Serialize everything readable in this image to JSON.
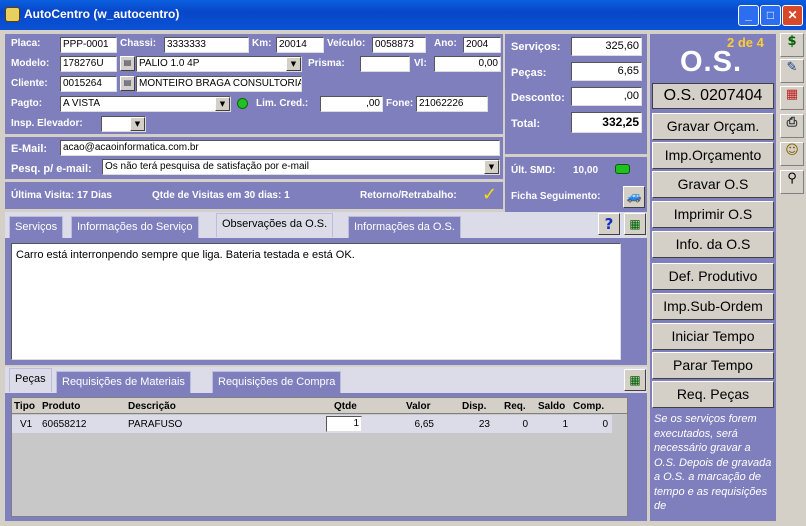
{
  "window": {
    "title": "AutoCentro (w_autocentro)",
    "minimize": "_",
    "maximize": "□",
    "close": "✕"
  },
  "vehicle": {
    "placa_label": "Placa:",
    "placa": "PPP-0001",
    "chassi_label": "Chassi:",
    "chassi": "3333333",
    "km_label": "Km:",
    "km": "20014",
    "veiculo_label": "Veículo:",
    "veiculo": "0058873",
    "ano_label": "Ano:",
    "ano": "2004",
    "modelo_label": "Modelo:",
    "modelo_code": "178276U",
    "modelo_name": "PALIO 1.0 4P",
    "prisma_label": "Prisma:",
    "prisma": "",
    "vl_label": "Vl:",
    "vl": "0,00",
    "cliente_label": "Cliente:",
    "cliente_code": "0015264",
    "cliente_name": "MONTEIRO BRAGA CONSULTORIA",
    "pagto_label": "Pagto:",
    "pagto": "A VISTA",
    "limcred_label": "Lim. Cred.:",
    "limcred": ",00",
    "fone_label": "Fone:",
    "fone": "21062226",
    "insp_label": "Insp. Elevador:",
    "insp": ""
  },
  "totals": {
    "servicos_label": "Serviços:",
    "servicos": "325,60",
    "pecas_label": "Peças:",
    "pecas": "6,65",
    "desconto_label": "Desconto:",
    "desconto": ",00",
    "total_label": "Total:",
    "total": "332,25"
  },
  "email": {
    "email_label": "E-Mail:",
    "email": "acao@acaoinformatica.com.br",
    "pesq_label": "Pesq. p/ e-mail:",
    "pesq": "Os não terá pesquisa de satisfação por e-mail"
  },
  "smd": {
    "label": "Últ. SMD:",
    "value": "10,00",
    "ficha_label": "Ficha Seguimento:"
  },
  "visits": {
    "ultima": "Última Visita:  17 Dias",
    "qtde": "Qtde de Visitas em 30 dias:   1",
    "retorno": "Retorno/Retrabalho:"
  },
  "tabs": [
    "Serviços",
    "Informações do Serviço",
    "Observações da O.S.",
    "Informações da O.S."
  ],
  "help": "?",
  "observacoes": "Carro está interronpendo sempre que liga. Bateria testada e está OK.",
  "lower_tabs": [
    "Peças",
    "Requisições de Materiais",
    "Requisições de Compra"
  ],
  "table": {
    "headers": [
      "Tipo",
      "Produto",
      "Descrição",
      "Qtde",
      "Valor",
      "Disp.",
      "Req.",
      "Saldo",
      "Comp."
    ],
    "rows": [
      [
        "V1",
        "60658212",
        "PARAFUSO",
        "1",
        "6,65",
        "23",
        "0",
        "1",
        "0"
      ]
    ]
  },
  "os": {
    "counter": "2 de 4",
    "label": "O.S.",
    "number": "O.S. 0207404"
  },
  "actions": [
    "Gravar Orçam.",
    "Imp.Orçamento",
    "Gravar O.S",
    "Imprimir O.S",
    "Info. da O.S",
    "Def. Produtivo",
    "Imp.Sub-Ordem",
    "Iniciar Tempo",
    "Parar Tempo",
    "Req. Peças"
  ],
  "help_text": "Se os serviços forem executados, será necessário gravar a O.S. Depois de gravada a O.S. a marcação de tempo e as requisições de",
  "toolbar": [
    "$",
    "✎",
    "▦",
    "⎙",
    "☺",
    "⚲"
  ],
  "colors": {
    "panel": "#7f7fbd",
    "title": "#0a53d6",
    "os_counter": "#ffcc33"
  }
}
